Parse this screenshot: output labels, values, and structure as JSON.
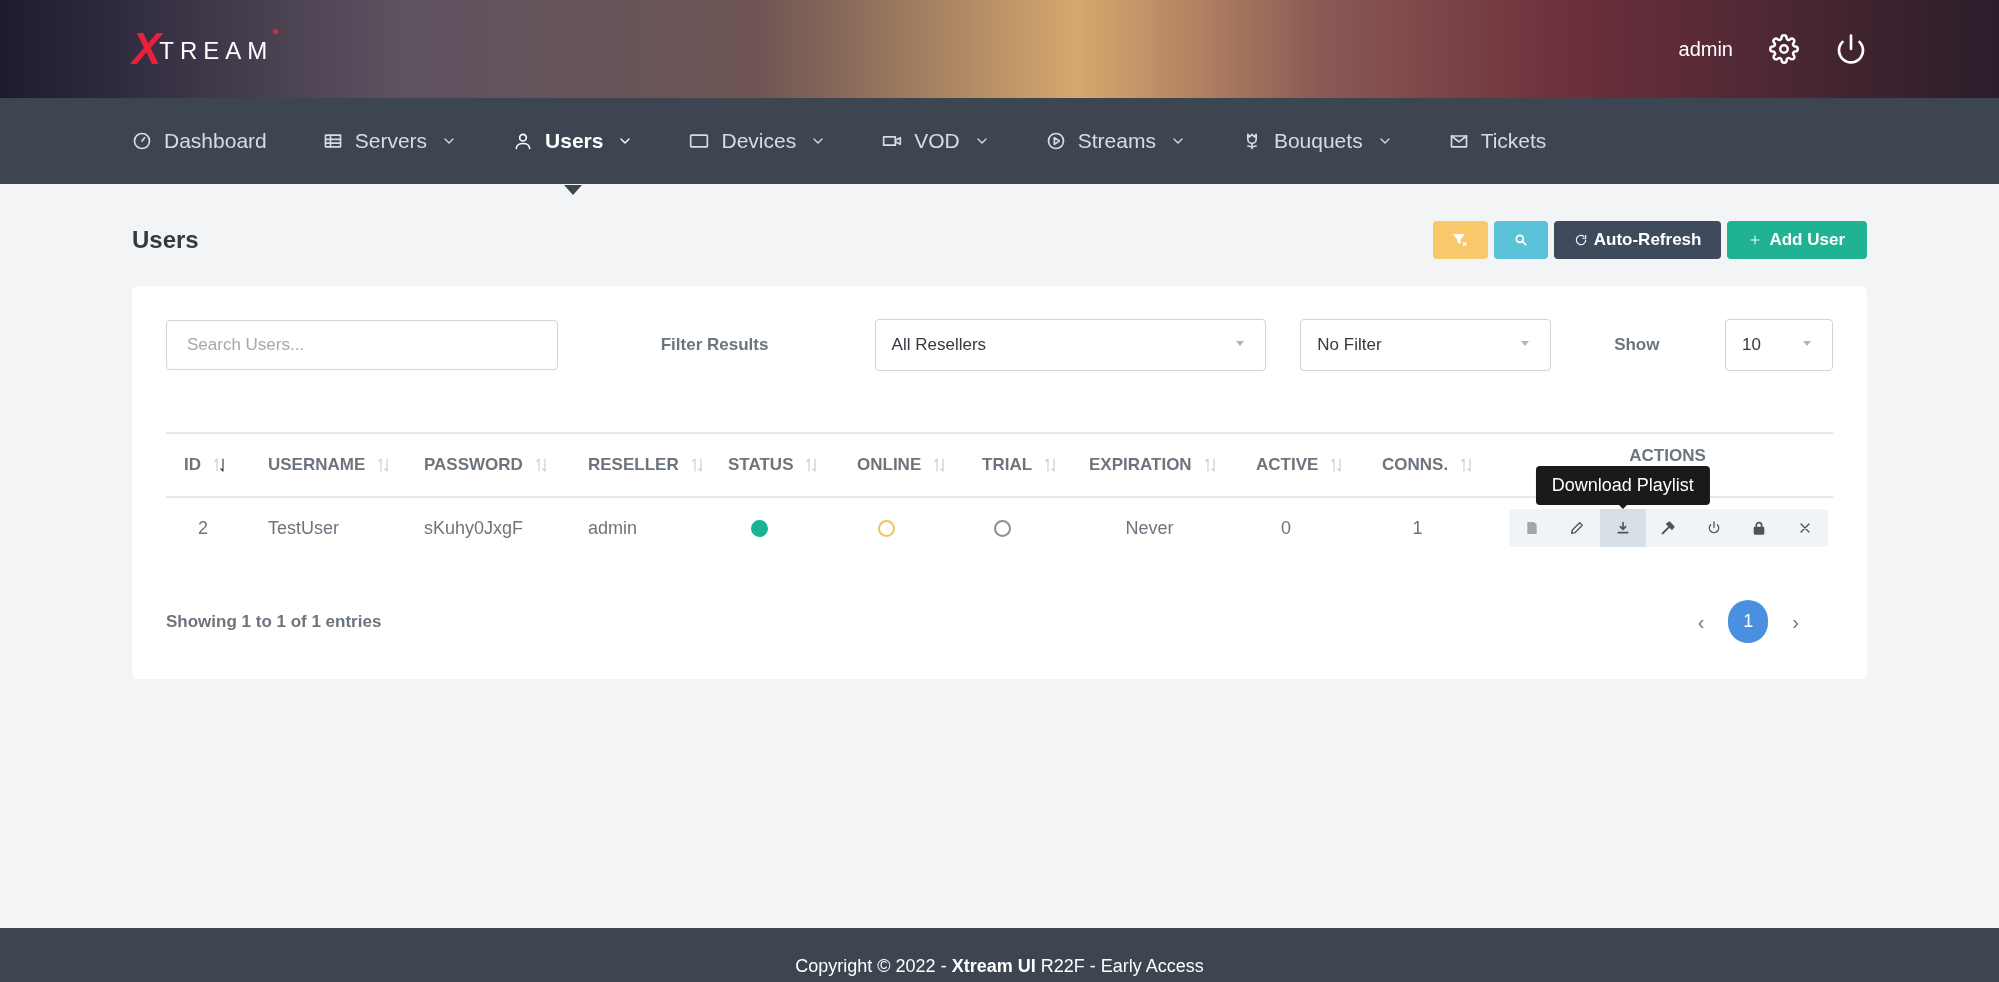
{
  "logo": {
    "mark": "X",
    "word": "TREAM"
  },
  "user_menu": {
    "username": "admin"
  },
  "nav": [
    {
      "label": "Dashboard",
      "kind": "gauge",
      "has_menu": false,
      "selected": false
    },
    {
      "label": "Servers",
      "kind": "server",
      "has_menu": true,
      "selected": false
    },
    {
      "label": "Users",
      "kind": "user",
      "has_menu": true,
      "selected": true
    },
    {
      "label": "Devices",
      "kind": "device",
      "has_menu": true,
      "selected": false
    },
    {
      "label": "VOD",
      "kind": "camera",
      "has_menu": true,
      "selected": false
    },
    {
      "label": "Streams",
      "kind": "play",
      "has_menu": true,
      "selected": false
    },
    {
      "label": "Bouquets",
      "kind": "flower",
      "has_menu": true,
      "selected": false
    },
    {
      "label": "Tickets",
      "kind": "mail",
      "has_menu": false,
      "selected": false
    }
  ],
  "page_title": "Users",
  "toolbar": [
    {
      "kind": "clear-filter"
    },
    {
      "kind": "search"
    },
    {
      "kind": "refresh",
      "label": "Auto-Refresh"
    },
    {
      "kind": "add",
      "label": "Add User"
    }
  ],
  "filters": {
    "search_placeholder": "Search Users...",
    "filter_label": "Filter Results",
    "reseller": "All Resellers",
    "status_filter": "No Filter",
    "show_label": "Show",
    "page_size": "10"
  },
  "table": {
    "columns": [
      {
        "label": "ID",
        "sorted": true
      },
      {
        "label": "USERNAME",
        "sorted": false
      },
      {
        "label": "PASSWORD",
        "sorted": false
      },
      {
        "label": "RESELLER",
        "sorted": false
      },
      {
        "label": "STATUS",
        "sorted": false
      },
      {
        "label": "ONLINE",
        "sorted": false
      },
      {
        "label": "TRIAL",
        "sorted": false
      },
      {
        "label": "EXPIRATION",
        "sorted": false
      },
      {
        "label": "ACTIVE",
        "sorted": false
      },
      {
        "label": "CONNS.",
        "sorted": false
      },
      {
        "label": "ACTIONS"
      }
    ],
    "rows": [
      {
        "id": "2",
        "username": "TestUser",
        "password": "sKuhy0JxgF",
        "reseller": "admin",
        "status": {
          "color": "#1ab394",
          "filled": true
        },
        "online": {
          "color": "#f3c35a",
          "filled": false
        },
        "trial": {
          "color": "#8a9097",
          "filled": false
        },
        "expiration": "Never",
        "active": "0",
        "conns": "1",
        "actions": [
          {
            "kind": "notes",
            "hovered": false
          },
          {
            "kind": "edit",
            "hovered": false
          },
          {
            "kind": "download",
            "hovered": true,
            "tooltip": "Download Playlist"
          },
          {
            "kind": "hammer",
            "hovered": false
          },
          {
            "kind": "power",
            "hovered": false
          },
          {
            "kind": "lock",
            "hovered": false
          },
          {
            "kind": "delete",
            "hovered": false
          }
        ]
      }
    ]
  },
  "summary": "Showing 1 to 1 of 1 entries",
  "pagination": {
    "prev": "‹",
    "pages": [
      {
        "label": "1",
        "selected": true
      }
    ],
    "next": "›"
  },
  "footer": "Copyright © 2022 - **Xtream UI** R22F - Early Access"
}
